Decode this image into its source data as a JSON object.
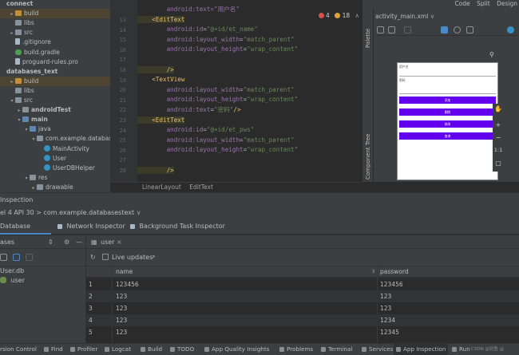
{
  "project_tree": [
    {
      "label": "connect",
      "indent": 0,
      "arrow": "",
      "icon": "none",
      "bold": true,
      "highlight": false
    },
    {
      "label": "build",
      "indent": 1,
      "arrow": "▸",
      "icon": "folder-orange",
      "highlight": true
    },
    {
      "label": "libs",
      "indent": 1,
      "arrow": "",
      "icon": "folder",
      "highlight": false
    },
    {
      "label": "src",
      "indent": 1,
      "arrow": "▸",
      "icon": "folder",
      "highlight": false
    },
    {
      "label": ".gitignore",
      "indent": 1,
      "arrow": "",
      "icon": "file",
      "highlight": false
    },
    {
      "label": "build.gradle",
      "indent": 1,
      "arrow": "",
      "icon": "gradle",
      "highlight": false
    },
    {
      "label": "proguard-rules.pro",
      "indent": 1,
      "arrow": "",
      "icon": "file",
      "highlight": false
    },
    {
      "label": "databases_text",
      "indent": 0,
      "arrow": "",
      "icon": "none",
      "bold": true,
      "highlight": false
    },
    {
      "label": "build",
      "indent": 1,
      "arrow": "▸",
      "icon": "folder-orange",
      "highlight": true
    },
    {
      "label": "libs",
      "indent": 1,
      "arrow": "",
      "icon": "folder",
      "highlight": false
    },
    {
      "label": "src",
      "indent": 1,
      "arrow": "▾",
      "icon": "folder",
      "highlight": false
    },
    {
      "label": "androidTest",
      "indent": 2,
      "arrow": "▸",
      "icon": "folder",
      "bold": true,
      "highlight": false
    },
    {
      "label": "main",
      "indent": 2,
      "arrow": "▾",
      "icon": "folder-blue",
      "bold": true,
      "highlight": false
    },
    {
      "label": "java",
      "indent": 3,
      "arrow": "▾",
      "icon": "folder-blue",
      "highlight": false
    },
    {
      "label": "com.example.databases_",
      "indent": 4,
      "arrow": "▾",
      "icon": "folder",
      "highlight": false
    },
    {
      "label": "MainActivity",
      "indent": 5,
      "arrow": "",
      "icon": "class",
      "highlight": false
    },
    {
      "label": "User",
      "indent": 5,
      "arrow": "",
      "icon": "class",
      "highlight": false
    },
    {
      "label": "UserDBHelper",
      "indent": 5,
      "arrow": "",
      "icon": "class",
      "highlight": false
    },
    {
      "label": "res",
      "indent": 3,
      "arrow": "▾",
      "icon": "folder",
      "highlight": false
    },
    {
      "label": "drawable",
      "indent": 4,
      "arrow": "▸",
      "icon": "folder",
      "highlight": false
    }
  ],
  "line_numbers": [
    "13",
    "14",
    "15",
    "16",
    "17",
    "18",
    "19",
    "20",
    "21",
    "22",
    "23",
    "24",
    "25",
    "26",
    "27",
    "28"
  ],
  "code_lines": [
    {
      "segs": [
        {
          "t": "        android:text=\"用户名\"",
          "c": "attr"
        }
      ],
      "partial": true
    },
    {
      "segs": [
        {
          "t": "    <EditText",
          "c": "tagbg"
        }
      ]
    },
    {
      "segs": [
        {
          "t": "        android:",
          "c": "ns"
        },
        {
          "t": "id",
          "c": "attr"
        },
        {
          "t": "=",
          "c": "pun"
        },
        {
          "t": "\"@+id/et_name\"",
          "c": "str"
        }
      ]
    },
    {
      "segs": [
        {
          "t": "        android:",
          "c": "ns"
        },
        {
          "t": "layout_width",
          "c": "attr"
        },
        {
          "t": "=",
          "c": "pun"
        },
        {
          "t": "\"match_parent\"",
          "c": "str"
        }
      ]
    },
    {
      "segs": [
        {
          "t": "        android:",
          "c": "ns"
        },
        {
          "t": "layout_height",
          "c": "attr"
        },
        {
          "t": "=",
          "c": "pun"
        },
        {
          "t": "\"wrap_content\"",
          "c": "str"
        }
      ]
    },
    {
      "segs": [
        {
          "t": "",
          "c": "pun"
        }
      ]
    },
    {
      "segs": [
        {
          "t": "        />",
          "c": "tagbg"
        }
      ]
    },
    {
      "segs": [
        {
          "t": "    <TextView",
          "c": "tag"
        }
      ]
    },
    {
      "segs": [
        {
          "t": "        android:",
          "c": "ns"
        },
        {
          "t": "layout_width",
          "c": "attr"
        },
        {
          "t": "=",
          "c": "pun"
        },
        {
          "t": "\"match_parent\"",
          "c": "str"
        }
      ]
    },
    {
      "segs": [
        {
          "t": "        android:",
          "c": "ns"
        },
        {
          "t": "layout_height",
          "c": "attr"
        },
        {
          "t": "=",
          "c": "pun"
        },
        {
          "t": "\"wrap_content\"",
          "c": "str"
        }
      ]
    },
    {
      "segs": [
        {
          "t": "        android:",
          "c": "ns"
        },
        {
          "t": "text",
          "c": "attr"
        },
        {
          "t": "=",
          "c": "pun"
        },
        {
          "t": "\"密码\"",
          "c": "str"
        },
        {
          "t": "/>",
          "c": "tag"
        }
      ]
    },
    {
      "segs": [
        {
          "t": "    <EditText",
          "c": "tagbg"
        }
      ]
    },
    {
      "segs": [
        {
          "t": "        android:",
          "c": "ns"
        },
        {
          "t": "id",
          "c": "attr"
        },
        {
          "t": "=",
          "c": "pun"
        },
        {
          "t": "\"@+id/et_pws\"",
          "c": "str"
        }
      ]
    },
    {
      "segs": [
        {
          "t": "        android:",
          "c": "ns"
        },
        {
          "t": "layout_width",
          "c": "attr"
        },
        {
          "t": "=",
          "c": "pun"
        },
        {
          "t": "\"match_parent\"",
          "c": "str"
        }
      ]
    },
    {
      "segs": [
        {
          "t": "        android:",
          "c": "ns"
        },
        {
          "t": "layout_height",
          "c": "attr"
        },
        {
          "t": "=",
          "c": "pun"
        },
        {
          "t": "\"wrap_content\"",
          "c": "str"
        }
      ]
    },
    {
      "segs": [
        {
          "t": "",
          "c": "pun"
        }
      ]
    },
    {
      "segs": [
        {
          "t": "        />",
          "c": "tagbg"
        }
      ]
    }
  ],
  "warnings": {
    "errors": "4",
    "warnings": "18"
  },
  "breadcrumb": [
    "LinearLayout",
    "EditText"
  ],
  "view_modes": {
    "code": "Code",
    "split": "Split",
    "design": "Design"
  },
  "design_tab": "activity_main.xml",
  "palette_label": "Palette",
  "component_tree_label": "Component Tree",
  "preview": {
    "label1": "用户名",
    "label2": "密码",
    "buttons": [
      "添加",
      "删除",
      "修改",
      "查询"
    ]
  },
  "zoom_controls": [
    "+",
    "−",
    "1:1"
  ],
  "inspection": {
    "title": "Inspection",
    "device": "el 4 API 30 > com.example.databasestext",
    "tabs": {
      "database": "Database Inspector",
      "network": "Network Inspector",
      "background": "Background Task Inspector"
    },
    "panel_label": "ases",
    "db_file": "User.db",
    "table": "user",
    "table_tab": "user",
    "live_updates": "Live updates",
    "columns": {
      "name": "name",
      "password": "password"
    },
    "rows": [
      {
        "idx": "1",
        "name": "123456",
        "password": "123456"
      },
      {
        "idx": "2",
        "name": "123",
        "password": "123"
      },
      {
        "idx": "3",
        "name": "123",
        "password": "123"
      },
      {
        "idx": "4",
        "name": "123",
        "password": "1234"
      },
      {
        "idx": "5",
        "name": "123",
        "password": "12345"
      }
    ]
  },
  "status_bar": [
    {
      "label": "rsion Control"
    },
    {
      "label": "Find"
    },
    {
      "label": "Profiler"
    },
    {
      "label": "Logcat"
    },
    {
      "label": "Build"
    },
    {
      "label": "TODO"
    },
    {
      "label": "App Quality Insights"
    },
    {
      "label": "Problems"
    },
    {
      "label": "Terminal"
    },
    {
      "label": "Services"
    },
    {
      "label": "App Inspection",
      "active": true
    },
    {
      "label": "Run"
    }
  ],
  "watermark": "CSDN @钓鱼 @"
}
